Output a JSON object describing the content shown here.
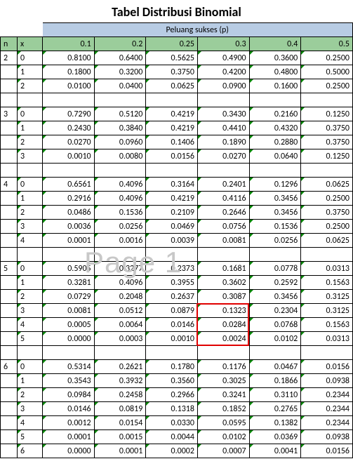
{
  "title": "Tabel Distribusi Binomial",
  "header_span": "Peluang sukses (p)",
  "col_n": "n",
  "col_x": "x",
  "p_headers": [
    "0.1",
    "0.2",
    "0.25",
    "0.3",
    "0.4",
    "0.5"
  ],
  "watermark": "Page 1",
  "chart_data": {
    "type": "table",
    "title": "Tabel Distribusi Binomial",
    "columns": [
      "n",
      "x",
      "0.1",
      "0.2",
      "0.25",
      "0.3",
      "0.4",
      "0.5"
    ],
    "xlabel": "Peluang sukses (p)",
    "groups": [
      {
        "n": 2,
        "rows": [
          {
            "x": 0,
            "v": [
              "0.8100",
              "0.6400",
              "0.5625",
              "0.4900",
              "0.3600",
              "0.2500"
            ]
          },
          {
            "x": 1,
            "v": [
              "0.1800",
              "0.3200",
              "0.3750",
              "0.4200",
              "0.4800",
              "0.5000"
            ]
          },
          {
            "x": 2,
            "v": [
              "0.0100",
              "0.0400",
              "0.0625",
              "0.0900",
              "0.1600",
              "0.2500"
            ]
          }
        ]
      },
      {
        "n": 3,
        "rows": [
          {
            "x": 0,
            "v": [
              "0.7290",
              "0.5120",
              "0.4219",
              "0.3430",
              "0.2160",
              "0.1250"
            ]
          },
          {
            "x": 1,
            "v": [
              "0.2430",
              "0.3840",
              "0.4219",
              "0.4410",
              "0.4320",
              "0.3750"
            ]
          },
          {
            "x": 2,
            "v": [
              "0.0270",
              "0.0960",
              "0.1406",
              "0.1890",
              "0.2880",
              "0.3750"
            ]
          },
          {
            "x": 3,
            "v": [
              "0.0010",
              "0.0080",
              "0.0156",
              "0.0270",
              "0.0640",
              "0.1250"
            ]
          }
        ]
      },
      {
        "n": 4,
        "rows": [
          {
            "x": 0,
            "v": [
              "0.6561",
              "0.4096",
              "0.3164",
              "0.2401",
              "0.1296",
              "0.0625"
            ]
          },
          {
            "x": 1,
            "v": [
              "0.2916",
              "0.4096",
              "0.4219",
              "0.4116",
              "0.3456",
              "0.2500"
            ]
          },
          {
            "x": 2,
            "v": [
              "0.0486",
              "0.1536",
              "0.2109",
              "0.2646",
              "0.3456",
              "0.3750"
            ]
          },
          {
            "x": 3,
            "v": [
              "0.0036",
              "0.0256",
              "0.0469",
              "0.0756",
              "0.1536",
              "0.2500"
            ]
          },
          {
            "x": 4,
            "v": [
              "0.0001",
              "0.0016",
              "0.0039",
              "0.0081",
              "0.0256",
              "0.0625"
            ]
          }
        ]
      },
      {
        "n": 5,
        "rows": [
          {
            "x": 0,
            "v": [
              "0.5905",
              "0.3277",
              "0.2373",
              "0.1681",
              "0.0778",
              "0.0313"
            ]
          },
          {
            "x": 1,
            "v": [
              "0.3281",
              "0.4096",
              "0.3955",
              "0.3602",
              "0.2592",
              "0.1563"
            ]
          },
          {
            "x": 2,
            "v": [
              "0.0729",
              "0.2048",
              "0.2637",
              "0.3087",
              "0.3456",
              "0.3125"
            ]
          },
          {
            "x": 3,
            "v": [
              "0.0081",
              "0.0512",
              "0.0879",
              "0.1323",
              "0.2304",
              "0.3125"
            ]
          },
          {
            "x": 4,
            "v": [
              "0.0005",
              "0.0064",
              "0.0146",
              "0.0284",
              "0.0768",
              "0.1563"
            ]
          },
          {
            "x": 5,
            "v": [
              "0.0000",
              "0.0003",
              "0.0010",
              "0.0024",
              "0.0102",
              "0.0313"
            ]
          }
        ]
      },
      {
        "n": 6,
        "rows": [
          {
            "x": 0,
            "v": [
              "0.5314",
              "0.2621",
              "0.1780",
              "0.1176",
              "0.0467",
              "0.0156"
            ]
          },
          {
            "x": 1,
            "v": [
              "0.3543",
              "0.3932",
              "0.3560",
              "0.3025",
              "0.1866",
              "0.0938"
            ]
          },
          {
            "x": 2,
            "v": [
              "0.0984",
              "0.2458",
              "0.2966",
              "0.3241",
              "0.3110",
              "0.2344"
            ]
          },
          {
            "x": 3,
            "v": [
              "0.0146",
              "0.0819",
              "0.1318",
              "0.1852",
              "0.2765",
              "0.2344"
            ]
          },
          {
            "x": 4,
            "v": [
              "0.0012",
              "0.0154",
              "0.0330",
              "0.0595",
              "0.1382",
              "0.2344"
            ]
          },
          {
            "x": 5,
            "v": [
              "0.0001",
              "0.0015",
              "0.0044",
              "0.0102",
              "0.0369",
              "0.0938"
            ]
          },
          {
            "x": 6,
            "v": [
              "0.0000",
              "0.0001",
              "0.0002",
              "0.0007",
              "0.0041",
              "0.0156"
            ]
          }
        ]
      }
    ],
    "highlight": {
      "n": 5,
      "p": "0.3",
      "x_range": [
        3,
        5
      ],
      "values": [
        "0.1323",
        "0.0284",
        "0.0024"
      ]
    }
  }
}
